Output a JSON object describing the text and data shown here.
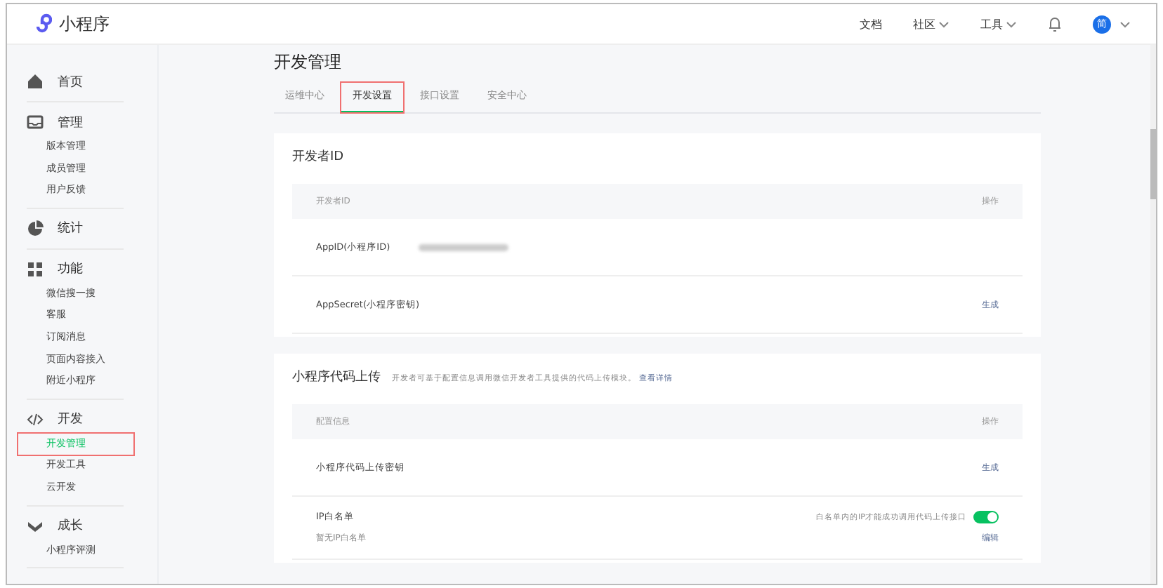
{
  "header": {
    "logo": "小程序",
    "nav": [
      {
        "label": "文档",
        "dropdown": false
      },
      {
        "label": "社区",
        "dropdown": true
      },
      {
        "label": "工具",
        "dropdown": true
      }
    ],
    "avatar": "简"
  },
  "sidebar": {
    "groups": [
      {
        "title": "首页"
      },
      {
        "title": "管理",
        "items": [
          {
            "label": "版本管理",
            "selected": false,
            "highlighted": false
          },
          {
            "label": "成员管理",
            "selected": false,
            "highlighted": false
          },
          {
            "label": "用户反馈",
            "selected": false,
            "highlighted": false
          }
        ]
      },
      {
        "title": "统计"
      },
      {
        "title": "功能",
        "items": [
          {
            "label": "微信搜一搜",
            "selected": false,
            "highlighted": false
          },
          {
            "label": "客服",
            "selected": false,
            "highlighted": false
          },
          {
            "label": "订阅消息",
            "selected": false,
            "highlighted": false
          },
          {
            "label": "页面内容接入",
            "selected": false,
            "highlighted": false
          },
          {
            "label": "附近小程序",
            "selected": false,
            "highlighted": false
          }
        ]
      },
      {
        "title": "开发",
        "items": [
          {
            "label": "开发管理",
            "selected": true,
            "highlighted": true
          },
          {
            "label": "开发工具",
            "selected": false,
            "highlighted": false
          },
          {
            "label": "云开发",
            "selected": false,
            "highlighted": false
          }
        ]
      },
      {
        "title": "成长",
        "items": [
          {
            "label": "小程序评测",
            "selected": false,
            "highlighted": false
          }
        ]
      }
    ]
  },
  "page": {
    "title": "开发管理",
    "tabs": [
      {
        "label": "运维中心",
        "selected": false,
        "highlighted": false
      },
      {
        "label": "开发设置",
        "selected": true,
        "highlighted": true
      },
      {
        "label": "接口设置",
        "selected": false,
        "highlighted": false
      },
      {
        "label": "安全中心",
        "selected": false,
        "highlighted": false
      }
    ]
  },
  "cards": [
    {
      "title": "开发者ID",
      "columns": [
        "开发者ID",
        "操作"
      ],
      "rows": [
        {
          "label": "AppID(小程序ID)",
          "value_redacted": true
        },
        {
          "label": "AppSecret(小程序密钥)",
          "action": "生成"
        }
      ]
    },
    {
      "title": "小程序代码上传",
      "description": "开发者可基于配置信息调用微信开发者工具提供的代码上传模块。",
      "link": "查看详情",
      "columns": [
        "配置信息",
        "操作"
      ],
      "rows": [
        {
          "label": "小程序代码上传密钥",
          "action": "生成"
        },
        {
          "label": "IP白名单",
          "sub": "暂无IP白名单",
          "note": "白名单内的IP才能成功调用代码上传接口",
          "toggle_on": true,
          "action": "编辑"
        }
      ]
    }
  ]
}
